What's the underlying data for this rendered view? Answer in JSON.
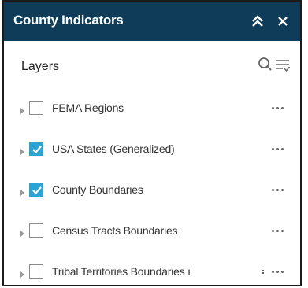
{
  "header": {
    "title": "County Indicators",
    "bg_color": "#0f3d59"
  },
  "layers_bar": {
    "label": "Layers"
  },
  "layers": [
    {
      "name": "FEMA Regions",
      "checked": false
    },
    {
      "name": "USA States (Generalized)",
      "checked": true
    },
    {
      "name": "County Boundaries",
      "checked": true
    },
    {
      "name": "Census Tracts Boundaries",
      "checked": false
    },
    {
      "name": "Tribal Territories Boundaries ı",
      "checked": false
    }
  ],
  "accent_color": "#2ba3d4",
  "icons": {
    "collapse": "double-chevron-up-icon",
    "close": "close-icon",
    "search": "search-icon",
    "filter": "filter-list-icon",
    "expand": "caret-right-icon",
    "more": "more-horizontal-icon",
    "check": "checkmark-icon"
  }
}
